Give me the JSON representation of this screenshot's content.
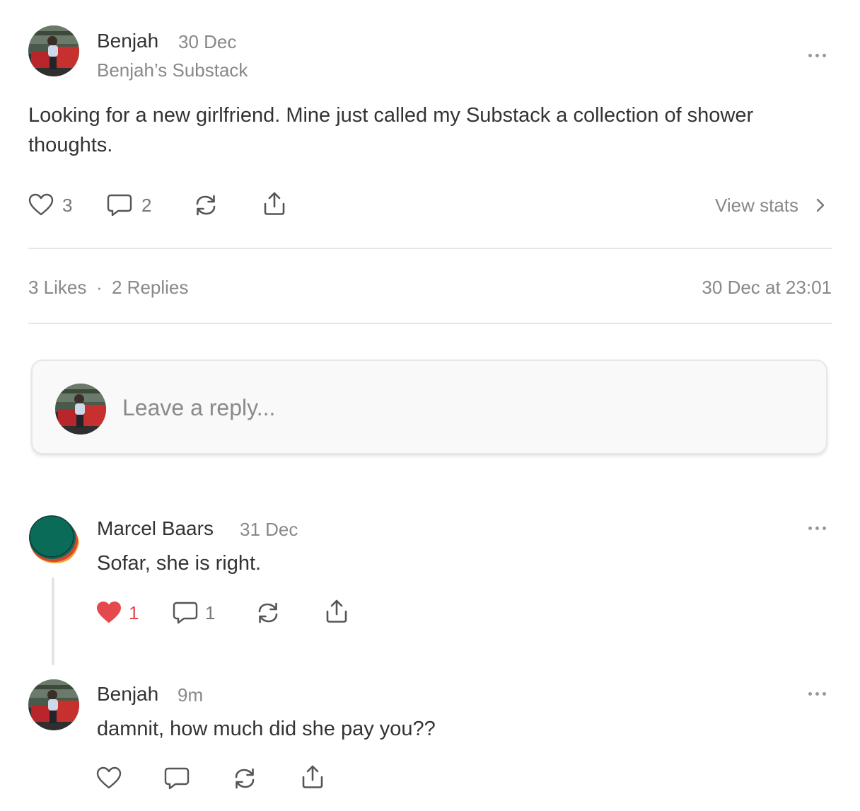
{
  "post": {
    "author": "Benjah",
    "date": "30 Dec",
    "publication": "Benjah’s Substack",
    "text": "Looking for a new girlfriend. Mine just called my Substack a collection of shower thoughts.",
    "likes_count": "3",
    "comments_count": "2",
    "view_stats_label": "View stats",
    "summary_likes": "3 Likes",
    "summary_separator": "·",
    "summary_replies": "2 Replies",
    "timestamp": "30 Dec at 23:01"
  },
  "reply_box": {
    "placeholder": "Leave a reply..."
  },
  "replies": [
    {
      "author": "Marcel Baars",
      "date": "31 Dec",
      "text": "Sofar, she is right.",
      "likes_count": "1",
      "comments_count": "1",
      "liked": true
    },
    {
      "author": "Benjah",
      "date": "9m",
      "text": "damnit, how much did she pay you??",
      "liked": false
    }
  ],
  "colors": {
    "like_active": "#e5484d",
    "text_muted": "#888888",
    "divider": "#e6e6e6"
  },
  "icons": {
    "like": "heart-icon",
    "comment": "speech-bubble-icon",
    "restack": "restack-icon",
    "share": "share-upload-icon",
    "more": "more-dots-icon",
    "chevron": "chevron-right-icon"
  }
}
